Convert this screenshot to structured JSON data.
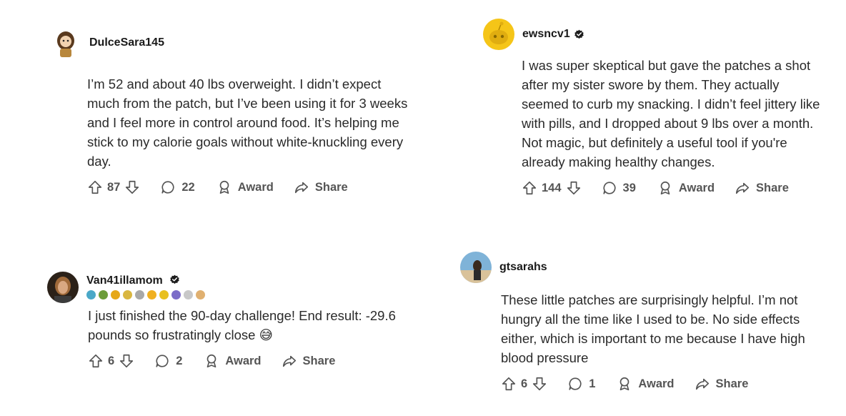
{
  "comments": [
    {
      "username": "DulceSara145",
      "verified": false,
      "text": "I’m 52 and about 40 lbs overweight. I didn’t expect much from the patch, but I’ve been using it for 3 weeks and I feel more in control around food. It’s helping me stick to my calorie goals without white-knuckling every day.",
      "votes": "87",
      "replies": "22",
      "award_label": "Award",
      "share_label": "Share"
    },
    {
      "username": "ewsncv1",
      "verified": true,
      "text": "I was super skeptical but gave the patches a shot after my sister swore by them. They actually seemed to curb my snacking. I didn’t feel jittery like with pills, and I dropped about 9 lbs over a month. Not magic, but definitely a useful tool if you're already making healthy changes.",
      "votes": "144",
      "replies": "39",
      "award_label": "Award",
      "share_label": "Share"
    },
    {
      "username": "Van41illamom",
      "verified": true,
      "text": "I just finished the 90-day challenge! End result: -29.6 pounds so frustratingly close 😅",
      "votes": "6",
      "replies": "2",
      "award_label": "Award",
      "share_label": "Share"
    },
    {
      "username": "gtsarahs",
      "verified": false,
      "text": "These little patches are surprisingly helpful. I’m not hungry all the time like I used to be. No side effects either, which is important to me because I have high blood pressure",
      "votes": "6",
      "replies": "1",
      "award_label": "Award",
      "share_label": "Share"
    }
  ],
  "icons": [
    "upvote-icon",
    "downvote-icon",
    "comment-icon",
    "award-icon",
    "share-icon",
    "verified-icon"
  ],
  "colors": {
    "text": "#2a2a2a",
    "meta": "#555555",
    "snoo_bg": "#f5c518"
  }
}
